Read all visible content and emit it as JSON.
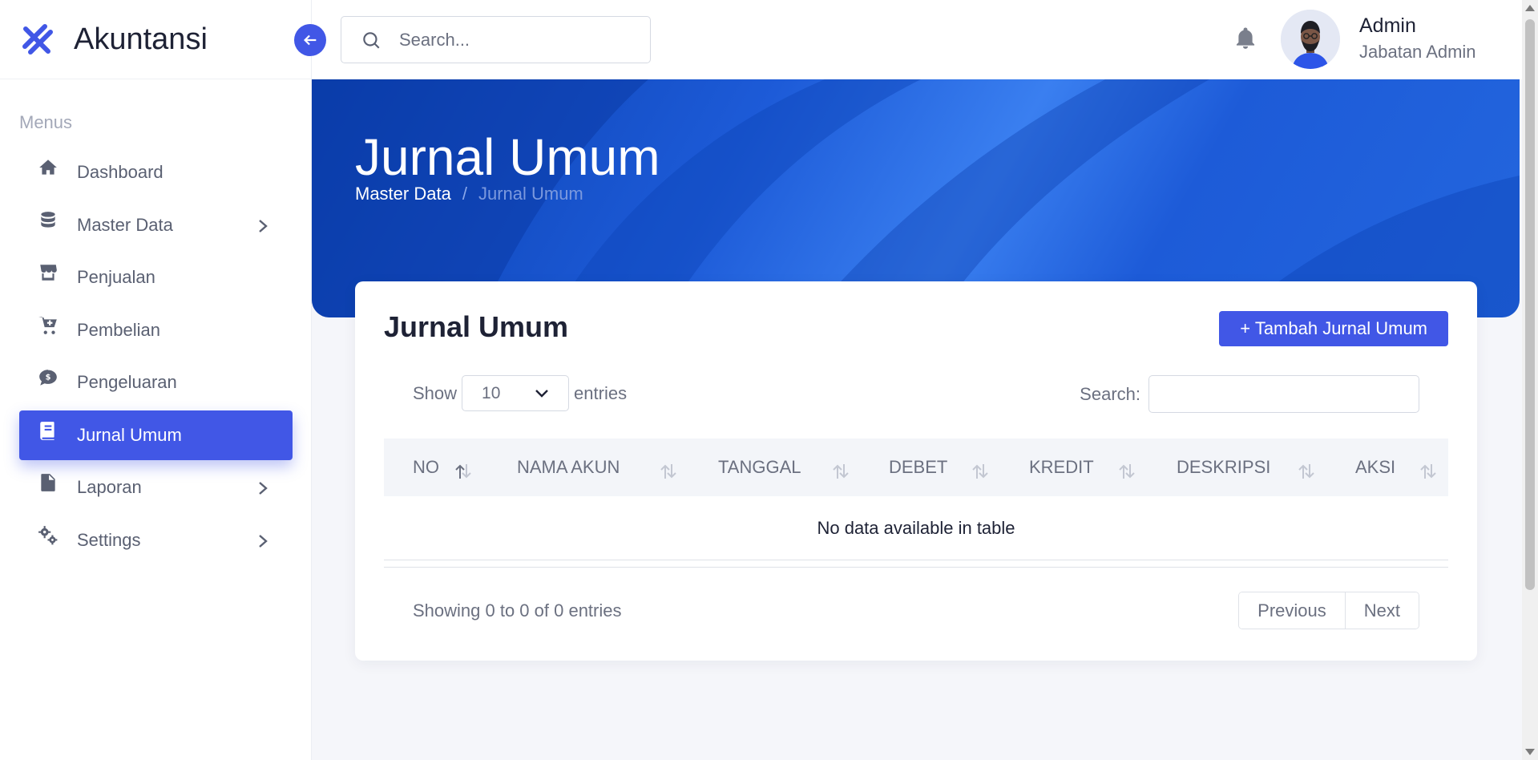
{
  "brand": {
    "name": "Akuntansi",
    "logo_icon": "logo-cross-icon"
  },
  "sidebar": {
    "section_label": "Menus",
    "items": [
      {
        "label": "Dashboard",
        "icon": "home-icon",
        "has_submenu": false,
        "active": false
      },
      {
        "label": "Master Data",
        "icon": "database-icon",
        "has_submenu": true,
        "active": false
      },
      {
        "label": "Penjualan",
        "icon": "store-icon",
        "has_submenu": false,
        "active": false
      },
      {
        "label": "Pembelian",
        "icon": "cart-plus-icon",
        "has_submenu": false,
        "active": false
      },
      {
        "label": "Pengeluaran",
        "icon": "money-comment-icon",
        "has_submenu": false,
        "active": false
      },
      {
        "label": "Jurnal Umum",
        "icon": "book-icon",
        "has_submenu": false,
        "active": true
      },
      {
        "label": "Laporan",
        "icon": "file-icon",
        "has_submenu": true,
        "active": false
      },
      {
        "label": "Settings",
        "icon": "gears-icon",
        "has_submenu": true,
        "active": false
      }
    ]
  },
  "topbar": {
    "search_placeholder": "Search...",
    "user": {
      "name": "Admin",
      "role": "Jabatan Admin"
    }
  },
  "hero": {
    "title": "Jurnal Umum",
    "breadcrumb": {
      "parent": "Master Data",
      "separator": "/",
      "current": "Jurnal Umum"
    }
  },
  "card": {
    "title": "Jurnal Umum",
    "add_button": "+ Tambah Jurnal Umum",
    "show_label": "Show",
    "entries_value": "10",
    "entries_label": "entries",
    "search_label": "Search:",
    "columns": [
      "NO",
      "NAMA AKUN",
      "TANGGAL",
      "DEBET",
      "KREDIT",
      "DESKRIPSI",
      "AKSI"
    ],
    "empty_message": "No data available in table",
    "info": "Showing 0 to 0 of 0 entries",
    "pager": {
      "previous": "Previous",
      "next": "Next"
    }
  },
  "colors": {
    "primary": "#4157e6",
    "hero_dark": "#0a3fae",
    "hero_light": "#3a7ff0",
    "text_muted": "#6b7080"
  }
}
